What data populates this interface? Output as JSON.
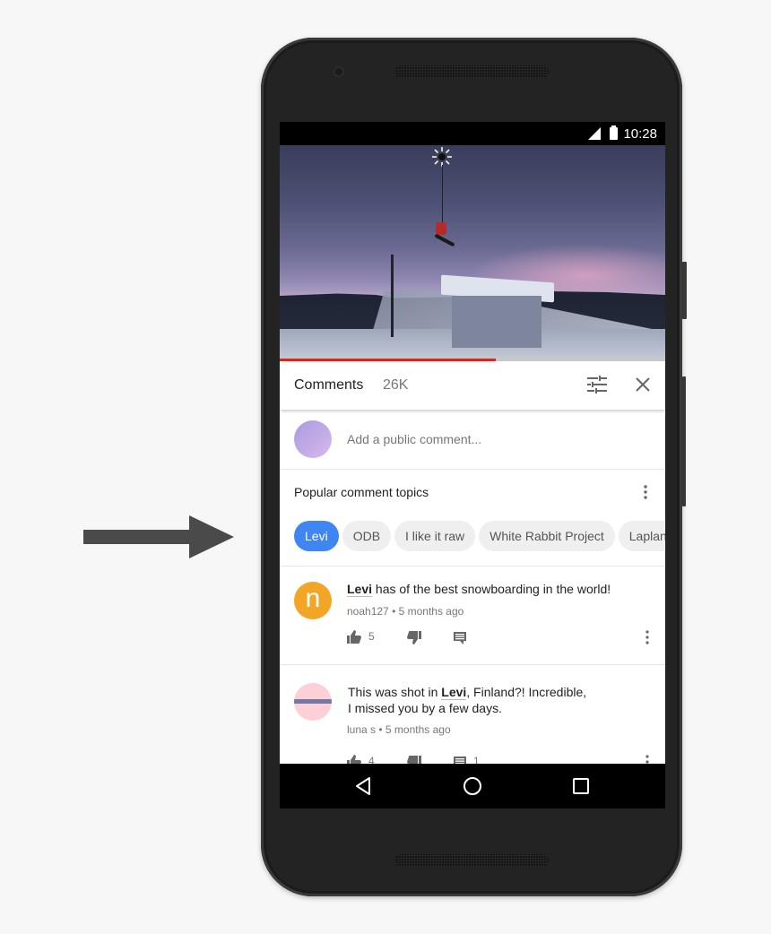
{
  "status_bar": {
    "time": "10:28",
    "icons": [
      "signal-icon",
      "battery-icon"
    ]
  },
  "video": {
    "progress_fraction": 0.56,
    "progress_color": "#e62117"
  },
  "comments_header": {
    "title": "Comments",
    "count": "26K",
    "sort_icon": "sort-sliders-icon",
    "close_icon": "close-icon"
  },
  "add_comment": {
    "placeholder": "Add a public comment..."
  },
  "topics": {
    "label": "Popular comment topics",
    "chips": [
      {
        "label": "Levi",
        "active": true
      },
      {
        "label": "ODB",
        "active": false
      },
      {
        "label": "I like it raw",
        "active": false
      },
      {
        "label": "White Rabbit Project",
        "active": false
      },
      {
        "label": "Laplan",
        "active": false
      }
    ],
    "accent_color": "#3f86f2"
  },
  "comments": [
    {
      "avatar_letter": "n",
      "avatar_color": "#f3a526",
      "highlight": "Levi",
      "text_after": " has of the best snowboarding in the world!",
      "author": "noah127",
      "separator": "•",
      "time": "5 months ago",
      "likes": "5",
      "replies": ""
    },
    {
      "avatar_color": "#fdd0d6",
      "text_before": "This was shot in ",
      "highlight": "Levi",
      "text_after": ", Finland?! Incredible,",
      "text_line2": "I missed you by a few days.",
      "author": "luna s",
      "separator": "•",
      "time": "5 months ago",
      "likes": "4",
      "replies": "1"
    }
  ],
  "nav_bar": {
    "buttons": [
      "back",
      "home",
      "recents"
    ]
  }
}
